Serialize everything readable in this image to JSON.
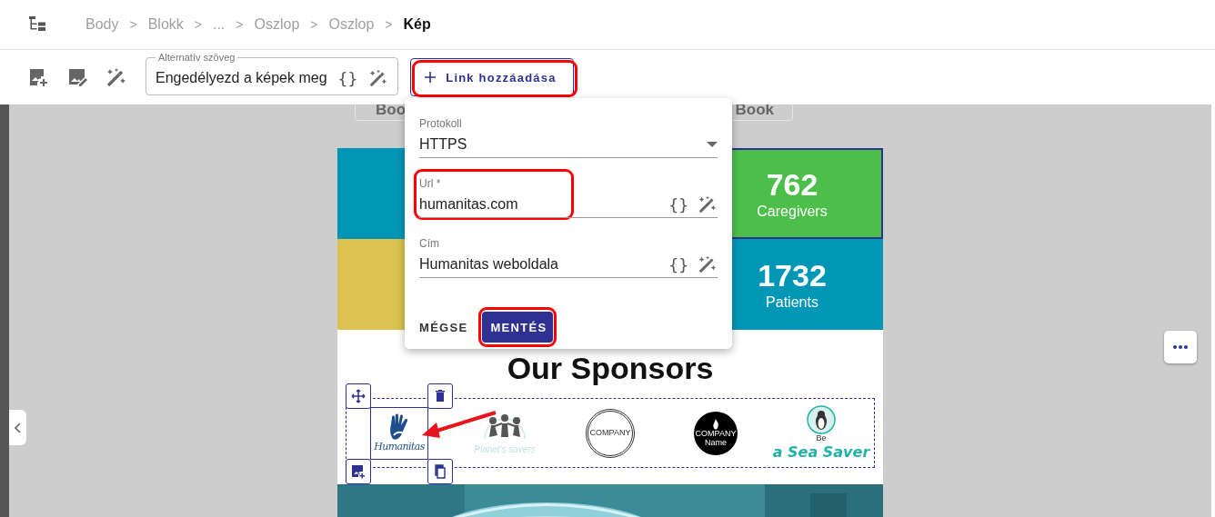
{
  "breadcrumb": {
    "items": [
      {
        "label": "Body",
        "current": false
      },
      {
        "label": "Blokk",
        "current": false
      },
      {
        "label": "...",
        "current": false
      },
      {
        "label": "Oszlop",
        "current": false
      },
      {
        "label": "Oszlop",
        "current": false
      },
      {
        "label": "Kép",
        "current": true
      }
    ],
    "separators": [
      ">",
      ">",
      ">",
      ">",
      ">"
    ]
  },
  "toolbar": {
    "tools": [
      {
        "kind": "image-add"
      },
      {
        "kind": "image-edit"
      },
      {
        "kind": "magic"
      }
    ],
    "alt_text": {
      "label": "Alternatív szöveg",
      "value": "Engedélyezd a képek meg",
      "symbol": "{}"
    },
    "link_button": {
      "label": "Link hozzáadása",
      "highlighted": true
    }
  },
  "email": {
    "buttons": [
      {
        "label": "Boo"
      },
      {
        "label": "Book"
      }
    ],
    "stats": [
      {
        "color": "#0097b7",
        "selected": false
      },
      {
        "value": "762",
        "label": "Caregivers",
        "color": "#4cbf4a",
        "selected": true
      },
      {
        "color": "#dcc34f",
        "selected": false
      },
      {
        "value": "1732",
        "label": "Patients",
        "color": "#0097b7",
        "selected": false
      }
    ],
    "sponsors": {
      "title": "Our Sponsors",
      "logos": [
        {
          "kind": "hand",
          "lines": [
            "Humanitas"
          ],
          "selected": true
        },
        {
          "kind": "figures",
          "lines": [
            "Planet's savers"
          ],
          "selected": false
        },
        {
          "kind": "ring",
          "lines": [
            "COMPANY"
          ],
          "selected": false
        },
        {
          "kind": "disc",
          "lines": [
            "COMPANY",
            "Name"
          ],
          "selected": false
        },
        {
          "kind": "penguin",
          "lines": [
            "Be",
            "a Sea Saver"
          ],
          "selected": false
        }
      ]
    }
  },
  "link_dialog": {
    "fields": [
      {
        "kind": "select",
        "label": "Protokoll",
        "value": "HTTPS",
        "highlighted": false
      },
      {
        "kind": "text",
        "label": "Url *",
        "value": "humanitas.com",
        "symbol": "{}",
        "highlighted": true
      },
      {
        "kind": "text",
        "label": "Cím",
        "value": "Humanitas weboldala",
        "symbol": "{}",
        "highlighted": false
      }
    ],
    "actions": [
      {
        "kind": "text",
        "label": "MÉGSE",
        "highlighted": false
      },
      {
        "kind": "primary",
        "label": "MENTÉS",
        "highlighted": true
      }
    ]
  }
}
